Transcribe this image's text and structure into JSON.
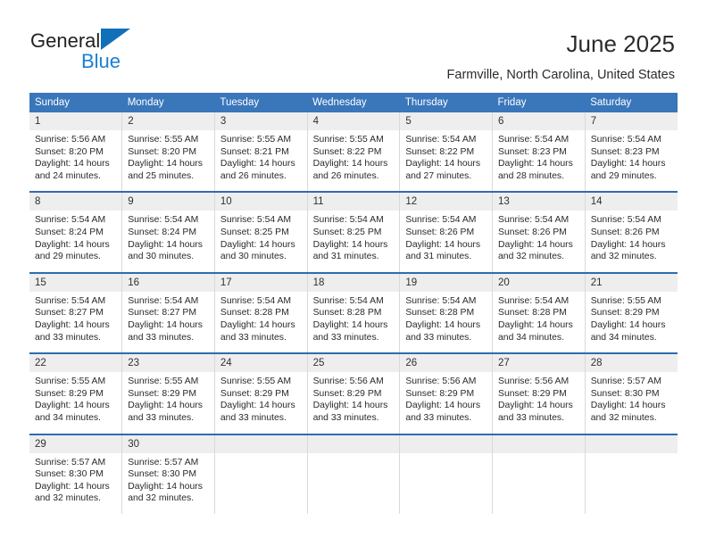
{
  "brand": {
    "name_top": "General",
    "name_bottom": "Blue",
    "triangle_color": "#1270b8",
    "blue_color": "#1b7fd4"
  },
  "header": {
    "title": "June 2025",
    "subtitle": "Farmville, North Carolina, United States"
  },
  "theme": {
    "header_bg": "#3a76ba",
    "header_text": "#ffffff",
    "daynum_bg": "#eeeeee",
    "row_divider": "#2f6cae",
    "cell_divider": "#d9d9d9"
  },
  "weekday_headers": [
    "Sunday",
    "Monday",
    "Tuesday",
    "Wednesday",
    "Thursday",
    "Friday",
    "Saturday"
  ],
  "weeks": [
    [
      {
        "day": "1",
        "sunrise": "Sunrise: 5:56 AM",
        "sunset": "Sunset: 8:20 PM",
        "daylight_line1": "Daylight: 14 hours",
        "daylight_line2": "and 24 minutes."
      },
      {
        "day": "2",
        "sunrise": "Sunrise: 5:55 AM",
        "sunset": "Sunset: 8:20 PM",
        "daylight_line1": "Daylight: 14 hours",
        "daylight_line2": "and 25 minutes."
      },
      {
        "day": "3",
        "sunrise": "Sunrise: 5:55 AM",
        "sunset": "Sunset: 8:21 PM",
        "daylight_line1": "Daylight: 14 hours",
        "daylight_line2": "and 26 minutes."
      },
      {
        "day": "4",
        "sunrise": "Sunrise: 5:55 AM",
        "sunset": "Sunset: 8:22 PM",
        "daylight_line1": "Daylight: 14 hours",
        "daylight_line2": "and 26 minutes."
      },
      {
        "day": "5",
        "sunrise": "Sunrise: 5:54 AM",
        "sunset": "Sunset: 8:22 PM",
        "daylight_line1": "Daylight: 14 hours",
        "daylight_line2": "and 27 minutes."
      },
      {
        "day": "6",
        "sunrise": "Sunrise: 5:54 AM",
        "sunset": "Sunset: 8:23 PM",
        "daylight_line1": "Daylight: 14 hours",
        "daylight_line2": "and 28 minutes."
      },
      {
        "day": "7",
        "sunrise": "Sunrise: 5:54 AM",
        "sunset": "Sunset: 8:23 PM",
        "daylight_line1": "Daylight: 14 hours",
        "daylight_line2": "and 29 minutes."
      }
    ],
    [
      {
        "day": "8",
        "sunrise": "Sunrise: 5:54 AM",
        "sunset": "Sunset: 8:24 PM",
        "daylight_line1": "Daylight: 14 hours",
        "daylight_line2": "and 29 minutes."
      },
      {
        "day": "9",
        "sunrise": "Sunrise: 5:54 AM",
        "sunset": "Sunset: 8:24 PM",
        "daylight_line1": "Daylight: 14 hours",
        "daylight_line2": "and 30 minutes."
      },
      {
        "day": "10",
        "sunrise": "Sunrise: 5:54 AM",
        "sunset": "Sunset: 8:25 PM",
        "daylight_line1": "Daylight: 14 hours",
        "daylight_line2": "and 30 minutes."
      },
      {
        "day": "11",
        "sunrise": "Sunrise: 5:54 AM",
        "sunset": "Sunset: 8:25 PM",
        "daylight_line1": "Daylight: 14 hours",
        "daylight_line2": "and 31 minutes."
      },
      {
        "day": "12",
        "sunrise": "Sunrise: 5:54 AM",
        "sunset": "Sunset: 8:26 PM",
        "daylight_line1": "Daylight: 14 hours",
        "daylight_line2": "and 31 minutes."
      },
      {
        "day": "13",
        "sunrise": "Sunrise: 5:54 AM",
        "sunset": "Sunset: 8:26 PM",
        "daylight_line1": "Daylight: 14 hours",
        "daylight_line2": "and 32 minutes."
      },
      {
        "day": "14",
        "sunrise": "Sunrise: 5:54 AM",
        "sunset": "Sunset: 8:26 PM",
        "daylight_line1": "Daylight: 14 hours",
        "daylight_line2": "and 32 minutes."
      }
    ],
    [
      {
        "day": "15",
        "sunrise": "Sunrise: 5:54 AM",
        "sunset": "Sunset: 8:27 PM",
        "daylight_line1": "Daylight: 14 hours",
        "daylight_line2": "and 33 minutes."
      },
      {
        "day": "16",
        "sunrise": "Sunrise: 5:54 AM",
        "sunset": "Sunset: 8:27 PM",
        "daylight_line1": "Daylight: 14 hours",
        "daylight_line2": "and 33 minutes."
      },
      {
        "day": "17",
        "sunrise": "Sunrise: 5:54 AM",
        "sunset": "Sunset: 8:28 PM",
        "daylight_line1": "Daylight: 14 hours",
        "daylight_line2": "and 33 minutes."
      },
      {
        "day": "18",
        "sunrise": "Sunrise: 5:54 AM",
        "sunset": "Sunset: 8:28 PM",
        "daylight_line1": "Daylight: 14 hours",
        "daylight_line2": "and 33 minutes."
      },
      {
        "day": "19",
        "sunrise": "Sunrise: 5:54 AM",
        "sunset": "Sunset: 8:28 PM",
        "daylight_line1": "Daylight: 14 hours",
        "daylight_line2": "and 33 minutes."
      },
      {
        "day": "20",
        "sunrise": "Sunrise: 5:54 AM",
        "sunset": "Sunset: 8:28 PM",
        "daylight_line1": "Daylight: 14 hours",
        "daylight_line2": "and 34 minutes."
      },
      {
        "day": "21",
        "sunrise": "Sunrise: 5:55 AM",
        "sunset": "Sunset: 8:29 PM",
        "daylight_line1": "Daylight: 14 hours",
        "daylight_line2": "and 34 minutes."
      }
    ],
    [
      {
        "day": "22",
        "sunrise": "Sunrise: 5:55 AM",
        "sunset": "Sunset: 8:29 PM",
        "daylight_line1": "Daylight: 14 hours",
        "daylight_line2": "and 34 minutes."
      },
      {
        "day": "23",
        "sunrise": "Sunrise: 5:55 AM",
        "sunset": "Sunset: 8:29 PM",
        "daylight_line1": "Daylight: 14 hours",
        "daylight_line2": "and 33 minutes."
      },
      {
        "day": "24",
        "sunrise": "Sunrise: 5:55 AM",
        "sunset": "Sunset: 8:29 PM",
        "daylight_line1": "Daylight: 14 hours",
        "daylight_line2": "and 33 minutes."
      },
      {
        "day": "25",
        "sunrise": "Sunrise: 5:56 AM",
        "sunset": "Sunset: 8:29 PM",
        "daylight_line1": "Daylight: 14 hours",
        "daylight_line2": "and 33 minutes."
      },
      {
        "day": "26",
        "sunrise": "Sunrise: 5:56 AM",
        "sunset": "Sunset: 8:29 PM",
        "daylight_line1": "Daylight: 14 hours",
        "daylight_line2": "and 33 minutes."
      },
      {
        "day": "27",
        "sunrise": "Sunrise: 5:56 AM",
        "sunset": "Sunset: 8:29 PM",
        "daylight_line1": "Daylight: 14 hours",
        "daylight_line2": "and 33 minutes."
      },
      {
        "day": "28",
        "sunrise": "Sunrise: 5:57 AM",
        "sunset": "Sunset: 8:30 PM",
        "daylight_line1": "Daylight: 14 hours",
        "daylight_line2": "and 32 minutes."
      }
    ],
    [
      {
        "day": "29",
        "sunrise": "Sunrise: 5:57 AM",
        "sunset": "Sunset: 8:30 PM",
        "daylight_line1": "Daylight: 14 hours",
        "daylight_line2": "and 32 minutes."
      },
      {
        "day": "30",
        "sunrise": "Sunrise: 5:57 AM",
        "sunset": "Sunset: 8:30 PM",
        "daylight_line1": "Daylight: 14 hours",
        "daylight_line2": "and 32 minutes."
      },
      {
        "day": "",
        "sunrise": "",
        "sunset": "",
        "daylight_line1": "",
        "daylight_line2": ""
      },
      {
        "day": "",
        "sunrise": "",
        "sunset": "",
        "daylight_line1": "",
        "daylight_line2": ""
      },
      {
        "day": "",
        "sunrise": "",
        "sunset": "",
        "daylight_line1": "",
        "daylight_line2": ""
      },
      {
        "day": "",
        "sunrise": "",
        "sunset": "",
        "daylight_line1": "",
        "daylight_line2": ""
      },
      {
        "day": "",
        "sunrise": "",
        "sunset": "",
        "daylight_line1": "",
        "daylight_line2": ""
      }
    ]
  ]
}
